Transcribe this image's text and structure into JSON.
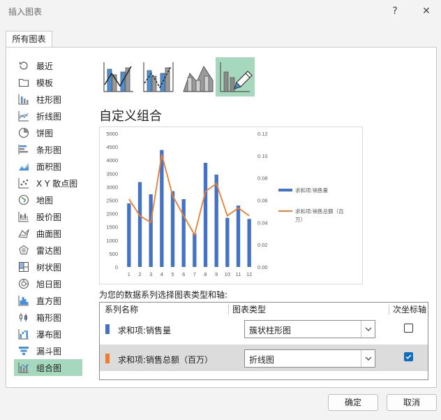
{
  "window": {
    "title": "插入图表",
    "help_label": "?",
    "close_label": "✕"
  },
  "tab": {
    "label": "所有图表"
  },
  "sidebar": {
    "items": [
      {
        "label": "最近",
        "icon": "recent-icon"
      },
      {
        "label": "模板",
        "icon": "template-icon"
      },
      {
        "label": "柱形图",
        "icon": "column-chart-icon"
      },
      {
        "label": "折线图",
        "icon": "line-chart-icon"
      },
      {
        "label": "饼图",
        "icon": "pie-chart-icon"
      },
      {
        "label": "条形图",
        "icon": "bar-chart-icon"
      },
      {
        "label": "面积图",
        "icon": "area-chart-icon"
      },
      {
        "label": "X Y 散点图",
        "icon": "scatter-chart-icon"
      },
      {
        "label": "地图",
        "icon": "map-chart-icon"
      },
      {
        "label": "股价图",
        "icon": "stock-chart-icon"
      },
      {
        "label": "曲面图",
        "icon": "surface-chart-icon"
      },
      {
        "label": "雷达图",
        "icon": "radar-chart-icon"
      },
      {
        "label": "树状图",
        "icon": "treemap-chart-icon"
      },
      {
        "label": "旭日图",
        "icon": "sunburst-chart-icon"
      },
      {
        "label": "直方图",
        "icon": "histogram-chart-icon"
      },
      {
        "label": "箱形图",
        "icon": "box-whisker-chart-icon"
      },
      {
        "label": "瀑布图",
        "icon": "waterfall-chart-icon"
      },
      {
        "label": "漏斗图",
        "icon": "funnel-chart-icon"
      },
      {
        "label": "组合图",
        "icon": "combo-chart-icon"
      }
    ],
    "selected_index": 18
  },
  "combo_types": {
    "selected_index": 3
  },
  "section_title": "自定义组合",
  "chart_data": {
    "type": "bar",
    "categories": [
      "1",
      "2",
      "3",
      "4",
      "5",
      "6",
      "7",
      "8",
      "9",
      "10",
      "11",
      "12"
    ],
    "series": [
      {
        "name": "求和项:销售量",
        "type": "bar",
        "axis": "primary",
        "color": "#4472c4",
        "values": [
          2380,
          3180,
          2720,
          4380,
          2840,
          2540,
          1250,
          3900,
          3460,
          1840,
          2300,
          1800
        ]
      },
      {
        "name": "求和项:销售总额（百万）",
        "type": "line",
        "axis": "secondary",
        "color": "#ed7d31",
        "values": [
          0.061,
          0.046,
          0.04,
          0.101,
          0.064,
          0.046,
          0.029,
          0.068,
          0.075,
          0.046,
          0.053,
          0.046
        ]
      }
    ],
    "y_ticks": [
      "0",
      "500",
      "1000",
      "1500",
      "2000",
      "2500",
      "3000",
      "3500",
      "4000",
      "4500",
      "5000"
    ],
    "y2_ticks": [
      "0.00",
      "0.02",
      "0.04",
      "0.06",
      "0.08",
      "0.10",
      "0.12"
    ],
    "ylim": [
      0,
      5000
    ],
    "y2lim": [
      0,
      0.12
    ],
    "grid": false,
    "legend_position": "right"
  },
  "legend": {
    "bar": "求和项:销售量",
    "line_1": "求和项:销售总额（百",
    "line_2": "万）"
  },
  "series_hint": "为您的数据系列选择图表类型和轴:",
  "table": {
    "headers": {
      "name": "系列名称",
      "type": "图表类型",
      "secondary": "次坐标轴"
    },
    "rows": [
      {
        "name": "求和项:销售量",
        "color": "#4472c4",
        "chart_type": "簇状柱形图",
        "secondary_axis": false
      },
      {
        "name": "求和项:销售总额（百万）",
        "color": "#ed7d31",
        "chart_type": "折线图",
        "secondary_axis": true
      }
    ]
  },
  "buttons": {
    "ok": "确定",
    "cancel": "取消"
  }
}
